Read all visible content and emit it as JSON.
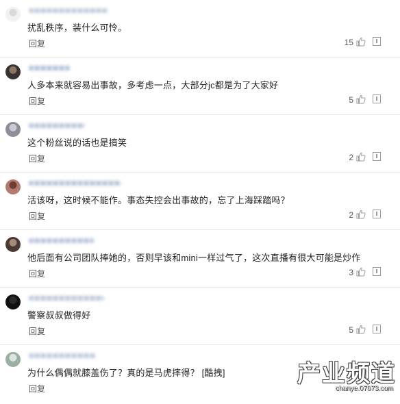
{
  "reply_label": "回复",
  "comments": [
    {
      "text": "扰乱秩序，装什么可怜。",
      "likes": "15",
      "avatar_color": "#f2f2f2",
      "avatar_accent": "#d9d9d9",
      "name_color": "#b7c3d6"
    },
    {
      "text": "人多本来就容易出事故，多考虑一点，大部分jc都是为了大家好",
      "likes": "5",
      "avatar_color": "#3a3230",
      "avatar_accent": "#8a7566",
      "name_color": "#9eb4d3"
    },
    {
      "text": "这个粉丝说的话也是搞笑",
      "likes": "2",
      "avatar_color": "#8c8f98",
      "avatar_accent": "#c9ccd6",
      "name_color": "#aab9d0"
    },
    {
      "text": "活该呀，这时候不能作。事态失控会出事故的，忘了上海踩踏吗？",
      "likes": "2",
      "avatar_color": "#b27a70",
      "avatar_accent": "#6f3d33",
      "name_color": "#a9b6cc"
    },
    {
      "text": "他后面有公司团队捧她的，否则早该和mini一样过气了，这次直播有很大可能是炒作",
      "likes": "3",
      "avatar_color": "#4a3a33",
      "avatar_accent": "#a58a7a",
      "name_color": "#a6b7d2"
    },
    {
      "text": "警察叔叔做得好",
      "likes": "5",
      "avatar_color": "#111111",
      "avatar_accent": "#2a2a2a",
      "name_color": "#b0bdd1"
    },
    {
      "text": "为什么偶偶就膝盖伤了？真的是马虎摔得？ [酷拽]",
      "likes": "",
      "avatar_color": "#9bb0a0",
      "avatar_accent": "#dfe6df",
      "name_color": "#b2c0d6"
    }
  ],
  "watermark": {
    "title": "产业频道",
    "url": "chanye.07073.com"
  },
  "colors": {
    "like_icon": "#9a9a9a",
    "divider": "#e9e9e9"
  }
}
